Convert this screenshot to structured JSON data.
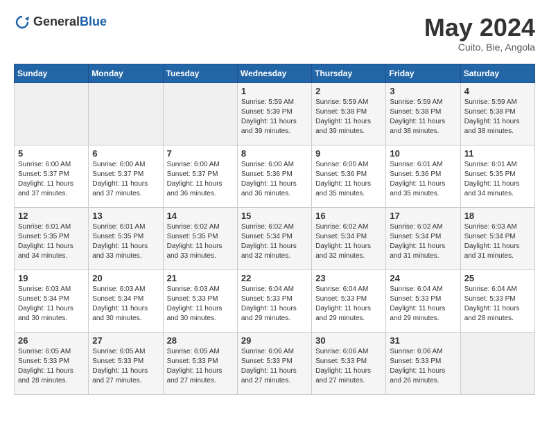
{
  "logo": {
    "text_general": "General",
    "text_blue": "Blue"
  },
  "title": {
    "month_year": "May 2024",
    "location": "Cuito, Bie, Angola"
  },
  "weekdays": [
    "Sunday",
    "Monday",
    "Tuesday",
    "Wednesday",
    "Thursday",
    "Friday",
    "Saturday"
  ],
  "weeks": [
    [
      {
        "day": "",
        "sunrise": "",
        "sunset": "",
        "daylight": "",
        "empty": true
      },
      {
        "day": "",
        "sunrise": "",
        "sunset": "",
        "daylight": "",
        "empty": true
      },
      {
        "day": "",
        "sunrise": "",
        "sunset": "",
        "daylight": "",
        "empty": true
      },
      {
        "day": "1",
        "sunrise": "Sunrise: 5:59 AM",
        "sunset": "Sunset: 5:39 PM",
        "daylight": "Daylight: 11 hours and 39 minutes."
      },
      {
        "day": "2",
        "sunrise": "Sunrise: 5:59 AM",
        "sunset": "Sunset: 5:38 PM",
        "daylight": "Daylight: 11 hours and 39 minutes."
      },
      {
        "day": "3",
        "sunrise": "Sunrise: 5:59 AM",
        "sunset": "Sunset: 5:38 PM",
        "daylight": "Daylight: 11 hours and 38 minutes."
      },
      {
        "day": "4",
        "sunrise": "Sunrise: 5:59 AM",
        "sunset": "Sunset: 5:38 PM",
        "daylight": "Daylight: 11 hours and 38 minutes."
      }
    ],
    [
      {
        "day": "5",
        "sunrise": "Sunrise: 6:00 AM",
        "sunset": "Sunset: 5:37 PM",
        "daylight": "Daylight: 11 hours and 37 minutes."
      },
      {
        "day": "6",
        "sunrise": "Sunrise: 6:00 AM",
        "sunset": "Sunset: 5:37 PM",
        "daylight": "Daylight: 11 hours and 37 minutes."
      },
      {
        "day": "7",
        "sunrise": "Sunrise: 6:00 AM",
        "sunset": "Sunset: 5:37 PM",
        "daylight": "Daylight: 11 hours and 36 minutes."
      },
      {
        "day": "8",
        "sunrise": "Sunrise: 6:00 AM",
        "sunset": "Sunset: 5:36 PM",
        "daylight": "Daylight: 11 hours and 36 minutes."
      },
      {
        "day": "9",
        "sunrise": "Sunrise: 6:00 AM",
        "sunset": "Sunset: 5:36 PM",
        "daylight": "Daylight: 11 hours and 35 minutes."
      },
      {
        "day": "10",
        "sunrise": "Sunrise: 6:01 AM",
        "sunset": "Sunset: 5:36 PM",
        "daylight": "Daylight: 11 hours and 35 minutes."
      },
      {
        "day": "11",
        "sunrise": "Sunrise: 6:01 AM",
        "sunset": "Sunset: 5:35 PM",
        "daylight": "Daylight: 11 hours and 34 minutes."
      }
    ],
    [
      {
        "day": "12",
        "sunrise": "Sunrise: 6:01 AM",
        "sunset": "Sunset: 5:35 PM",
        "daylight": "Daylight: 11 hours and 34 minutes."
      },
      {
        "day": "13",
        "sunrise": "Sunrise: 6:01 AM",
        "sunset": "Sunset: 5:35 PM",
        "daylight": "Daylight: 11 hours and 33 minutes."
      },
      {
        "day": "14",
        "sunrise": "Sunrise: 6:02 AM",
        "sunset": "Sunset: 5:35 PM",
        "daylight": "Daylight: 11 hours and 33 minutes."
      },
      {
        "day": "15",
        "sunrise": "Sunrise: 6:02 AM",
        "sunset": "Sunset: 5:34 PM",
        "daylight": "Daylight: 11 hours and 32 minutes."
      },
      {
        "day": "16",
        "sunrise": "Sunrise: 6:02 AM",
        "sunset": "Sunset: 5:34 PM",
        "daylight": "Daylight: 11 hours and 32 minutes."
      },
      {
        "day": "17",
        "sunrise": "Sunrise: 6:02 AM",
        "sunset": "Sunset: 5:34 PM",
        "daylight": "Daylight: 11 hours and 31 minutes."
      },
      {
        "day": "18",
        "sunrise": "Sunrise: 6:03 AM",
        "sunset": "Sunset: 5:34 PM",
        "daylight": "Daylight: 11 hours and 31 minutes."
      }
    ],
    [
      {
        "day": "19",
        "sunrise": "Sunrise: 6:03 AM",
        "sunset": "Sunset: 5:34 PM",
        "daylight": "Daylight: 11 hours and 30 minutes."
      },
      {
        "day": "20",
        "sunrise": "Sunrise: 6:03 AM",
        "sunset": "Sunset: 5:34 PM",
        "daylight": "Daylight: 11 hours and 30 minutes."
      },
      {
        "day": "21",
        "sunrise": "Sunrise: 6:03 AM",
        "sunset": "Sunset: 5:33 PM",
        "daylight": "Daylight: 11 hours and 30 minutes."
      },
      {
        "day": "22",
        "sunrise": "Sunrise: 6:04 AM",
        "sunset": "Sunset: 5:33 PM",
        "daylight": "Daylight: 11 hours and 29 minutes."
      },
      {
        "day": "23",
        "sunrise": "Sunrise: 6:04 AM",
        "sunset": "Sunset: 5:33 PM",
        "daylight": "Daylight: 11 hours and 29 minutes."
      },
      {
        "day": "24",
        "sunrise": "Sunrise: 6:04 AM",
        "sunset": "Sunset: 5:33 PM",
        "daylight": "Daylight: 11 hours and 29 minutes."
      },
      {
        "day": "25",
        "sunrise": "Sunrise: 6:04 AM",
        "sunset": "Sunset: 5:33 PM",
        "daylight": "Daylight: 11 hours and 28 minutes."
      }
    ],
    [
      {
        "day": "26",
        "sunrise": "Sunrise: 6:05 AM",
        "sunset": "Sunset: 5:33 PM",
        "daylight": "Daylight: 11 hours and 28 minutes."
      },
      {
        "day": "27",
        "sunrise": "Sunrise: 6:05 AM",
        "sunset": "Sunset: 5:33 PM",
        "daylight": "Daylight: 11 hours and 27 minutes."
      },
      {
        "day": "28",
        "sunrise": "Sunrise: 6:05 AM",
        "sunset": "Sunset: 5:33 PM",
        "daylight": "Daylight: 11 hours and 27 minutes."
      },
      {
        "day": "29",
        "sunrise": "Sunrise: 6:06 AM",
        "sunset": "Sunset: 5:33 PM",
        "daylight": "Daylight: 11 hours and 27 minutes."
      },
      {
        "day": "30",
        "sunrise": "Sunrise: 6:06 AM",
        "sunset": "Sunset: 5:33 PM",
        "daylight": "Daylight: 11 hours and 27 minutes."
      },
      {
        "day": "31",
        "sunrise": "Sunrise: 6:06 AM",
        "sunset": "Sunset: 5:33 PM",
        "daylight": "Daylight: 11 hours and 26 minutes."
      },
      {
        "day": "",
        "sunrise": "",
        "sunset": "",
        "daylight": "",
        "empty": true
      }
    ]
  ]
}
